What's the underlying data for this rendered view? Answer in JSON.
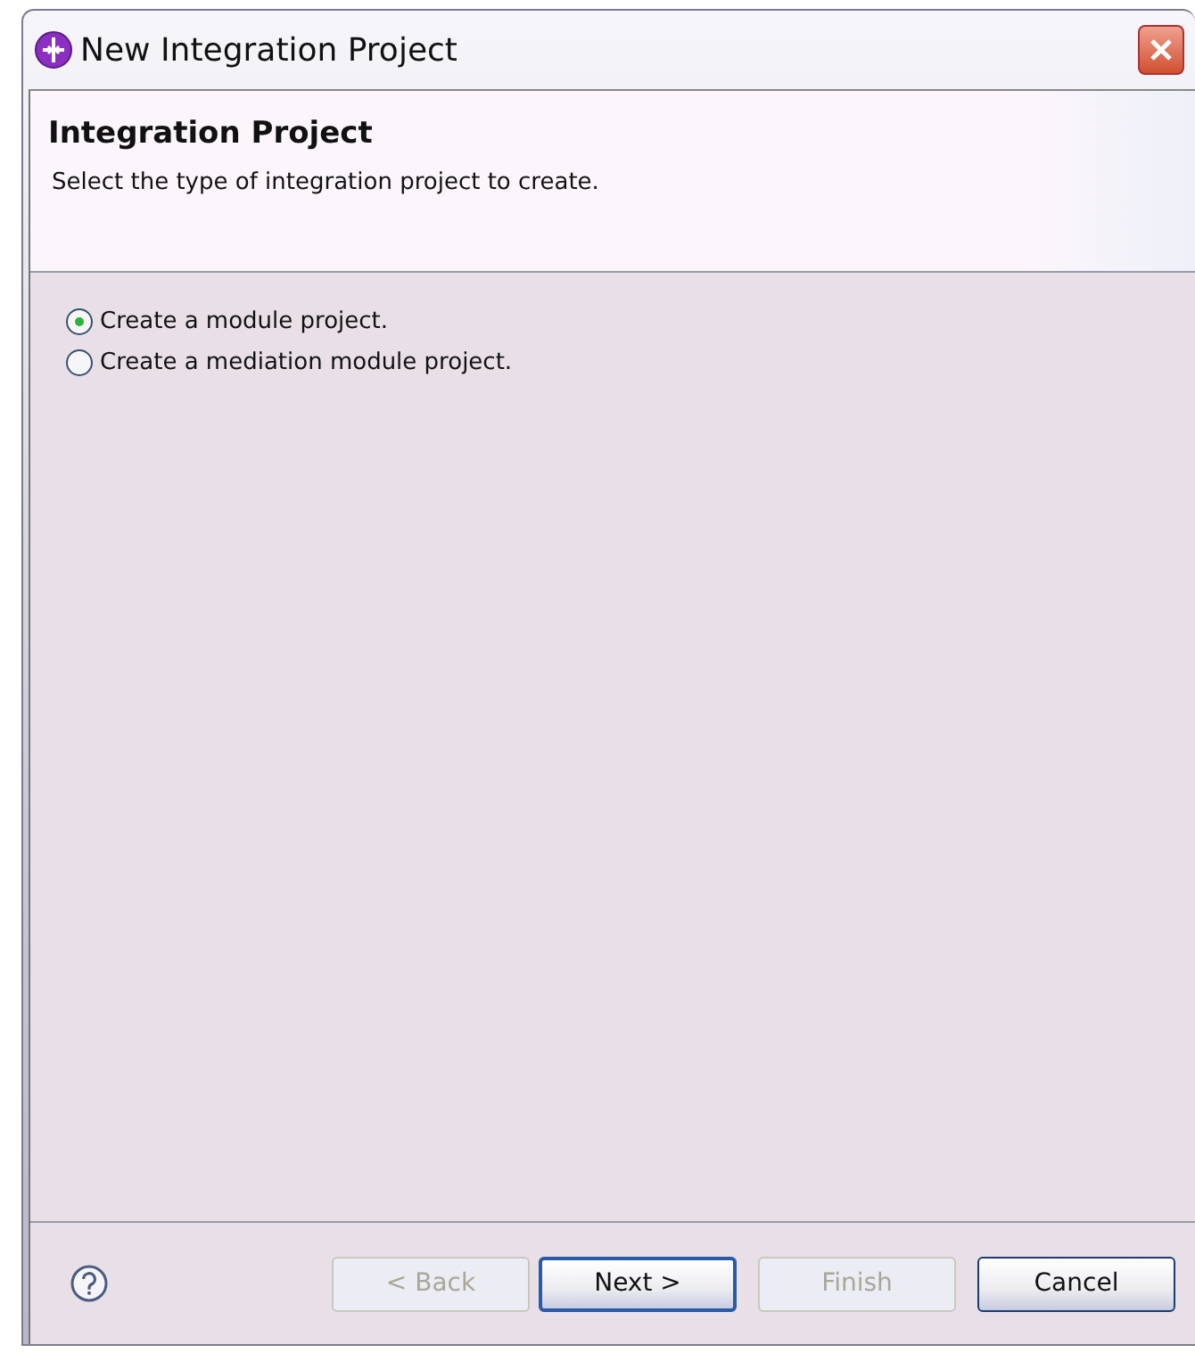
{
  "window": {
    "title": "New Integration Project"
  },
  "header": {
    "title": "Integration Project",
    "description": "Select the type of integration project to create."
  },
  "options": [
    {
      "label": "Create a module project.",
      "selected": true
    },
    {
      "label": "Create a mediation module project.",
      "selected": false
    }
  ],
  "buttons": [
    {
      "label": "< Back",
      "disabled": true,
      "default": false
    },
    {
      "label": "Next >",
      "disabled": false,
      "default": true
    },
    {
      "label": "Finish",
      "disabled": true,
      "default": false
    },
    {
      "label": "Cancel",
      "disabled": false,
      "default": false
    }
  ]
}
